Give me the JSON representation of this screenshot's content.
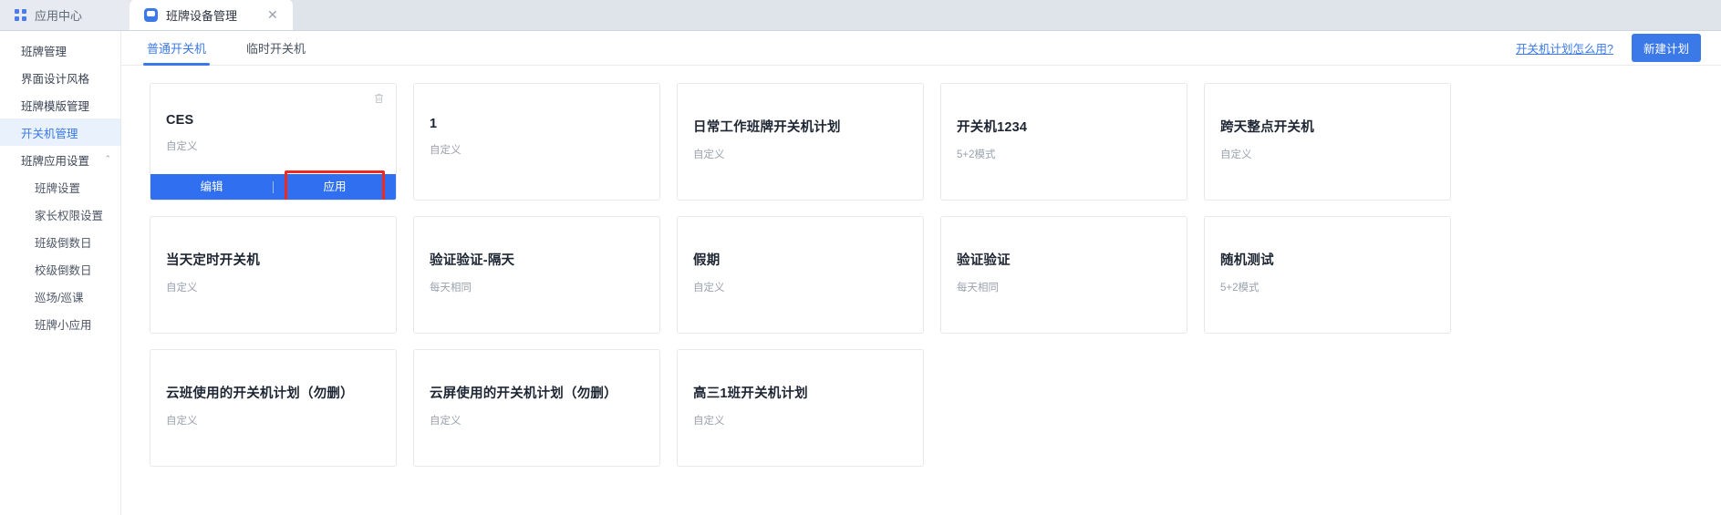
{
  "browser_tabs": [
    {
      "label": "应用中心",
      "icon": "grid-icon",
      "active": false,
      "closable": false
    },
    {
      "label": "班牌设备管理",
      "icon": "chat-bubble-icon",
      "active": true,
      "closable": true,
      "close_glyph": "✕"
    }
  ],
  "sidebar": {
    "items": [
      {
        "label": "班牌管理",
        "active": false,
        "sub": false
      },
      {
        "label": "界面设计风格",
        "active": false,
        "sub": false
      },
      {
        "label": "班牌模版管理",
        "active": false,
        "sub": false
      },
      {
        "label": "开关机管理",
        "active": true,
        "sub": false
      },
      {
        "label": "班牌应用设置",
        "active": false,
        "sub": false,
        "caret": "⌃"
      },
      {
        "label": "班牌设置",
        "active": false,
        "sub": true
      },
      {
        "label": "家长权限设置",
        "active": false,
        "sub": true
      },
      {
        "label": "班级倒数日",
        "active": false,
        "sub": true
      },
      {
        "label": "校级倒数日",
        "active": false,
        "sub": true
      },
      {
        "label": "巡场/巡课",
        "active": false,
        "sub": true
      },
      {
        "label": "班牌小应用",
        "active": false,
        "sub": true
      }
    ]
  },
  "toolbar": {
    "tabs": [
      {
        "label": "普通开关机",
        "active": true
      },
      {
        "label": "临时开关机",
        "active": false
      }
    ],
    "help_link": "开关机计划怎么用?",
    "new_plan_button": "新建计划"
  },
  "cards": [
    {
      "title": "CES",
      "subtitle": "自定义",
      "has_trash": true,
      "footer": {
        "edit": "编辑",
        "apply": "应用",
        "highlight": "apply"
      }
    },
    {
      "title": "1",
      "subtitle": "自定义",
      "has_trash": false,
      "footer": null
    },
    {
      "title": "日常工作班牌开关机计划",
      "subtitle": "自定义",
      "has_trash": false,
      "footer": null
    },
    {
      "title": "开关机1234",
      "subtitle": "5+2模式",
      "has_trash": false,
      "footer": null
    },
    {
      "title": "跨天整点开关机",
      "subtitle": "自定义",
      "has_trash": false,
      "footer": null
    },
    {
      "title": "当天定时开关机",
      "subtitle": "自定义",
      "has_trash": false,
      "footer": null
    },
    {
      "title": "验证验证-隔天",
      "subtitle": "每天相同",
      "has_trash": false,
      "footer": null
    },
    {
      "title": "假期",
      "subtitle": "自定义",
      "has_trash": false,
      "footer": null
    },
    {
      "title": "验证验证",
      "subtitle": "每天相同",
      "has_trash": false,
      "footer": null
    },
    {
      "title": "随机测试",
      "subtitle": "5+2模式",
      "has_trash": false,
      "footer": null
    },
    {
      "title": "云班使用的开关机计划（勿删）",
      "subtitle": "自定义",
      "has_trash": false,
      "footer": null
    },
    {
      "title": "云屏使用的开关机计划（勿删）",
      "subtitle": "自定义",
      "has_trash": false,
      "footer": null
    },
    {
      "title": "高三1班开关机计划",
      "subtitle": "自定义",
      "has_trash": false,
      "footer": null
    }
  ],
  "colors": {
    "accent": "#3b79e8",
    "footer_blue": "#2f6ff0",
    "highlight_red": "#ee2a20",
    "sidebar_active_bg": "#e9f1fd",
    "muted_text": "#9aa2ae"
  }
}
